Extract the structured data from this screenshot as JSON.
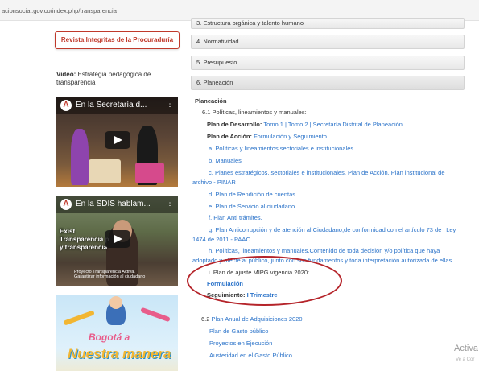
{
  "browser": {
    "url": "acionsocial.gov.co/index.php/transparencia"
  },
  "sidebar": {
    "revista_label": "Revista Integritas de la Procuraduría",
    "video_prefix": "Video:",
    "video_text": "Estrategia pedagógica de transparencia",
    "video1_title": "En la Secretaría d...",
    "video2_title": "En la SDIS hablam...",
    "video2_overlay": [
      "Exist",
      "Transparencia p",
      "y transparencia"
    ],
    "video2_caption": "Proyecto Transparencia Activa. Garantizar información al ciudadano",
    "banner_line1": "Bogotá a",
    "banner_line2": "Nuestra manera"
  },
  "accordion": [
    {
      "label": "3. Estructura orgánica y talento humano"
    },
    {
      "label": "4. Normatividad"
    },
    {
      "label": "5. Presupuesto"
    },
    {
      "label": "6. Planeación"
    }
  ],
  "planeacion": {
    "heading": "Planeación",
    "s61": "6.1  Políticas, lineamientos y manuales:",
    "desarrollo_label": "Plan de Desarrollo:",
    "tomo1": "Tomo 1",
    "tomo2": "Tomo 2",
    "secretaria": "Secretaría Distrital de Planeación",
    "accion_label": "Plan de Acción:",
    "accion_link": "Formulación y Seguimiento",
    "a_label": "a.",
    "a_link": "Políticas y lineamientos sectoriales e institucionales",
    "b_label": "b.",
    "b_link": "Manuales",
    "c_label": "c.",
    "c_link_1": "Planes estratégicos, sectoriales e institucionales, Plan de Acción, Plan institucional de",
    "c_link_2": "archivo - PINAR",
    "d_label": "d.",
    "d_link": "Plan de Rendición de cuentas",
    "e_label": "e.",
    "e_link": "Plan de Servicio al ciudadano.",
    "f_label": "f.",
    "f_link": "Plan Anti trámites.",
    "g_label": "g.",
    "g_link_1": "Plan Anticorrupción y de atención al Ciudadano,de conformidad con el artículo 73 de l Ley",
    "g_link_2": "1474 de 2011 - PAAC.",
    "h_label": "h.",
    "h_link_1": "Políticas, lineamientos y manuales.Contenido de toda decisión y/o política que haya",
    "h_link_2": "adoptado y afecte al público, junto con sus fundamentos y toda interpretación autorizada de ellas.",
    "i_text": "i. Plan de ajuste MIPG vigencia 2020:",
    "formulacion": "Formulación",
    "seguimiento_label": "Seguimiento:",
    "trimestre": "I Trimestre",
    "s62_prefix": "6.2",
    "s62_link": "Plan Anual de Adquisiciones 2020",
    "gasto": "Plan de Gasto público",
    "proyectos": "Proyectos en Ejecución",
    "austeridad": "Austeridad en el Gasto Público"
  },
  "watermark": {
    "line1": "Activa",
    "line2": "Ve a Cor"
  },
  "colors": {
    "link": "#2b73c9",
    "accent": "#b5242a"
  }
}
